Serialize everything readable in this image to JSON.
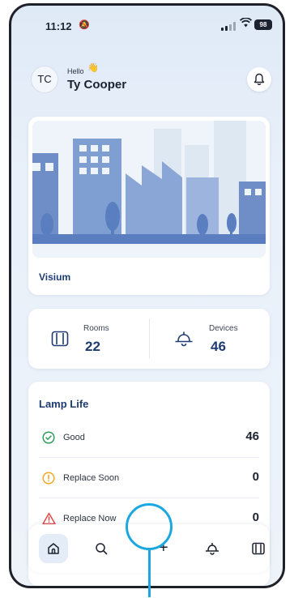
{
  "status_bar": {
    "time": "11:12",
    "battery": "98"
  },
  "header": {
    "avatar_initials": "TC",
    "greeting": "Hello",
    "wave_emoji": "👋",
    "user_name": "Ty Cooper"
  },
  "site": {
    "name": "Visium"
  },
  "stats": {
    "rooms": {
      "label": "Rooms",
      "value": "22"
    },
    "devices": {
      "label": "Devices",
      "value": "46"
    }
  },
  "lamp_life": {
    "title": "Lamp Life",
    "rows": [
      {
        "label": "Good",
        "value": "46",
        "status_color": "#2e9e5b"
      },
      {
        "label": "Replace Soon",
        "value": "0",
        "status_color": "#f0a928"
      },
      {
        "label": "Replace Now",
        "value": "0",
        "status_color": "#e14a4a"
      }
    ]
  },
  "nav": {
    "items": [
      "home-icon",
      "search-icon",
      "plus-icon",
      "lamp-icon",
      "rooms-icon"
    ],
    "plus_label": "+"
  },
  "colors": {
    "accent": "#1e3c72",
    "highlight": "#1ba8e0",
    "illustration": "#5b7ec0"
  }
}
